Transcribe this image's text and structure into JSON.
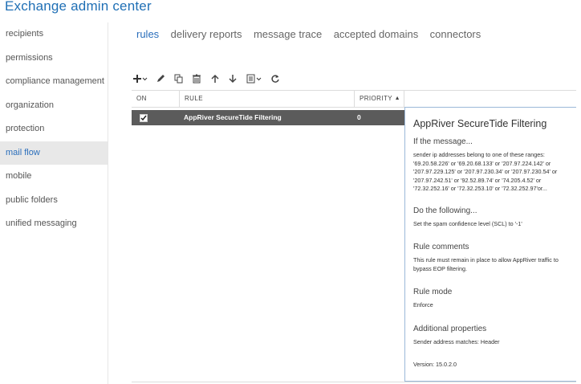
{
  "app": {
    "title": "Exchange admin center"
  },
  "nav": {
    "items": [
      {
        "label": "recipients"
      },
      {
        "label": "permissions"
      },
      {
        "label": "compliance management"
      },
      {
        "label": "organization"
      },
      {
        "label": "protection"
      },
      {
        "label": "mail flow",
        "active": true
      },
      {
        "label": "mobile"
      },
      {
        "label": "public folders"
      },
      {
        "label": "unified messaging"
      }
    ]
  },
  "tabs": [
    {
      "label": "rules",
      "active": true
    },
    {
      "label": "delivery reports"
    },
    {
      "label": "message trace"
    },
    {
      "label": "accepted domains"
    },
    {
      "label": "connectors"
    }
  ],
  "toolbar": {
    "icons": [
      "add-icon",
      "edit-icon",
      "copy-icon",
      "delete-icon",
      "move-up-icon",
      "move-down-icon",
      "more-icon",
      "refresh-icon"
    ]
  },
  "grid": {
    "headers": {
      "on": "ON",
      "rule": "RULE",
      "priority": "PRIORITY",
      "sort_indicator": "▲"
    },
    "rows": [
      {
        "on": true,
        "rule": "AppRiver SecureTide Filtering",
        "priority": "0"
      }
    ]
  },
  "details": {
    "title": "AppRiver SecureTide Filtering",
    "if_heading": "If the message...",
    "if_text": "sender ip addresses belong to one of these ranges: '69.20.58.226' or '69.20.68.133' or '207.97.224.142' or '207.97.229.125' or '207.97.230.34' or '207.97.230.54' or '207.97.242.51' or '92.52.89.74' or '74.205.4.52' or '72.32.252.16' or '72.32.253.10' or '72.32.252.97'or...",
    "do_heading": "Do the following...",
    "do_text": "Set the spam confidence level (SCL) to '-1'",
    "comments_heading": "Rule comments",
    "comments_text": "This rule must remain in place to allow AppRiver traffic to bypass EOP filtering.",
    "mode_heading": "Rule mode",
    "mode_text": "Enforce",
    "props_heading": "Additional properties",
    "props_text": "Sender address matches: Header",
    "version_text": "Version: 15.0.2.0"
  }
}
